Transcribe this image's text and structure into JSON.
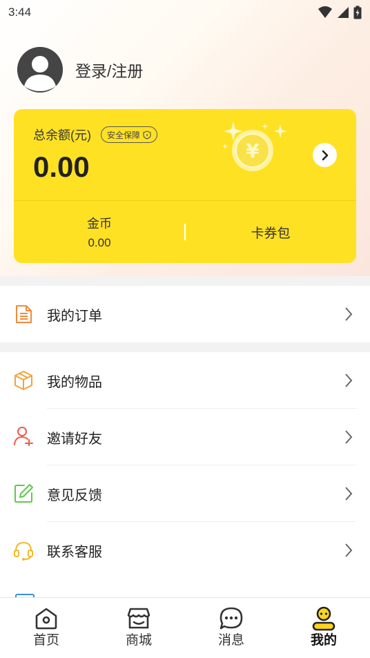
{
  "status_bar": {
    "time": "3:44"
  },
  "profile": {
    "login_label": "登录/注册"
  },
  "wallet": {
    "balance_label": "总余额(元)",
    "safety_badge": "安全保障",
    "balance_value": "0.00",
    "coin_label": "金币",
    "coin_value": "0.00",
    "coupon_label": "卡券包",
    "accent_color": "#ffe124"
  },
  "menu": {
    "orders": "我的订单",
    "items": "我的物品",
    "invite": "邀请好友",
    "feedback": "意见反馈",
    "service": "联系客服"
  },
  "tabs": [
    {
      "label": "首页",
      "icon": "home-icon"
    },
    {
      "label": "商城",
      "icon": "store-icon"
    },
    {
      "label": "消息",
      "icon": "message-icon"
    },
    {
      "label": "我的",
      "icon": "profile-icon",
      "active": true
    }
  ]
}
